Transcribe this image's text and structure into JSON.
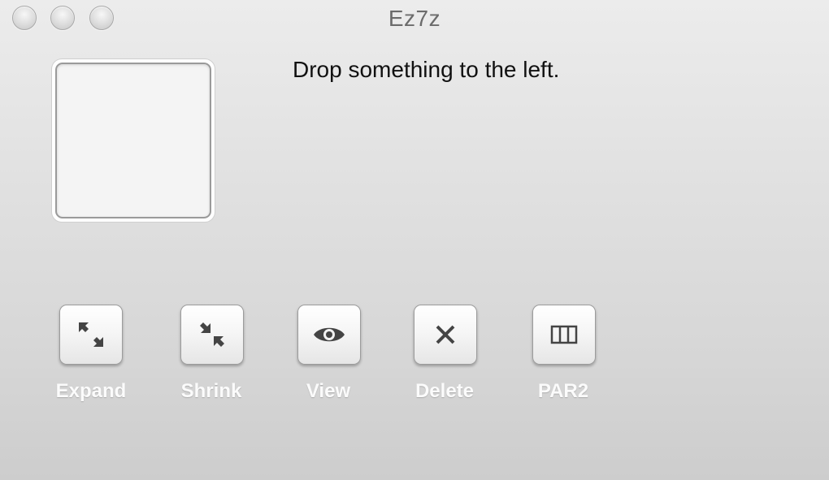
{
  "window": {
    "title": "Ez7z"
  },
  "main": {
    "message": "Drop something to the left."
  },
  "toolbar": {
    "buttons": [
      {
        "label": "Expand",
        "icon": "expand-icon"
      },
      {
        "label": "Shrink",
        "icon": "shrink-icon"
      },
      {
        "label": "View",
        "icon": "eye-icon"
      },
      {
        "label": "Delete",
        "icon": "delete-x-icon"
      },
      {
        "label": "PAR2",
        "icon": "par2-blocks-icon"
      }
    ]
  },
  "colors": {
    "icon": "#444444",
    "label": "#fbfbfb",
    "background": "#e3e3e3"
  }
}
